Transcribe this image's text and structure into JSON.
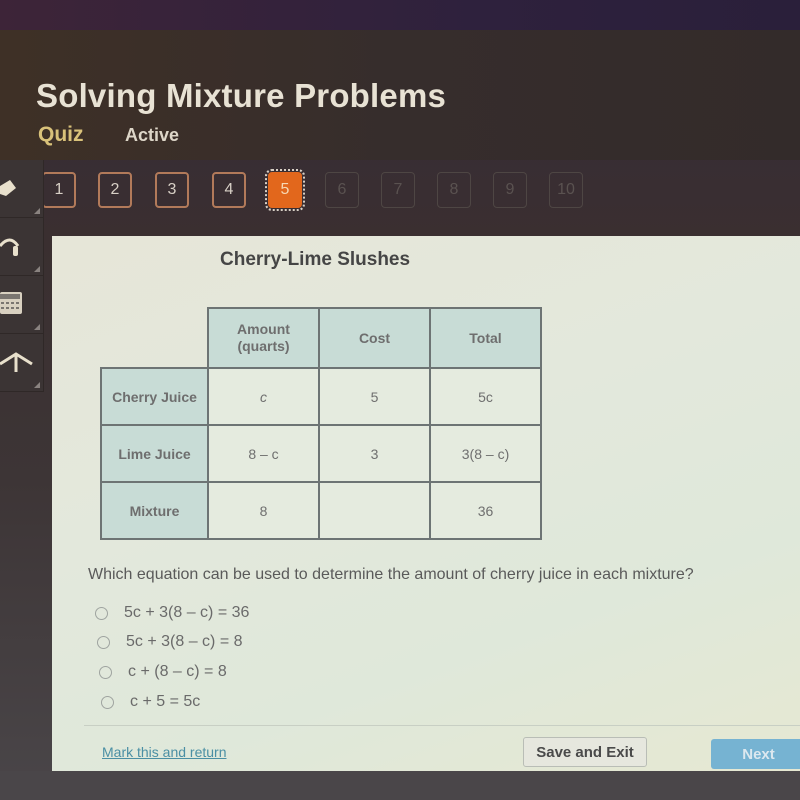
{
  "header": {
    "title": "Solving Mixture Problems",
    "type_label": "Quiz",
    "status_label": "Active"
  },
  "question_nav": {
    "current": 5,
    "items": [
      {
        "label": "1",
        "state": "answered"
      },
      {
        "label": "2",
        "state": "answered"
      },
      {
        "label": "3",
        "state": "answered"
      },
      {
        "label": "4",
        "state": "answered"
      },
      {
        "label": "5",
        "state": "current"
      },
      {
        "label": "6",
        "state": "disabled"
      },
      {
        "label": "7",
        "state": "disabled"
      },
      {
        "label": "8",
        "state": "disabled"
      },
      {
        "label": "9",
        "state": "disabled"
      },
      {
        "label": "10",
        "state": "disabled"
      }
    ]
  },
  "toolbar": {
    "items": [
      {
        "icon": "pencil-icon"
      },
      {
        "icon": "headphones-icon"
      },
      {
        "icon": "calculator-icon"
      },
      {
        "icon": "arrow-up-icon"
      }
    ]
  },
  "table": {
    "title": "Cherry-Lime Slushes",
    "columns": [
      "Amount (quarts)",
      "Cost",
      "Total"
    ],
    "column_lines": [
      [
        "Amount",
        "(quarts)"
      ],
      [
        "Cost"
      ],
      [
        "Total"
      ]
    ],
    "rows": [
      {
        "label": "Cherry Juice",
        "cells": [
          "c",
          "5",
          "5c"
        ]
      },
      {
        "label": "Lime Juice",
        "cells": [
          "8 – c",
          "3",
          "3(8 – c)"
        ]
      },
      {
        "label": "Mixture",
        "cells": [
          "8",
          "",
          "36"
        ]
      }
    ]
  },
  "question": {
    "text": "Which equation can be used to determine the amount of cherry juice in each mixture?",
    "options": [
      {
        "label": "5c + 3(8 – c) = 36",
        "selected": false
      },
      {
        "label": "5c + 3(8 – c) = 8",
        "selected": false
      },
      {
        "label": "c + (8 – c) = 8",
        "selected": false
      },
      {
        "label": "c + 5 = 5c",
        "selected": false
      }
    ]
  },
  "footer": {
    "mark_link": "Mark this and return",
    "save_button": "Save and Exit",
    "next_button": "Next"
  },
  "colors": {
    "accent_current": "#e2671c",
    "quiz_label": "#d9c27a",
    "next_button": "#76b3d2",
    "link": "#4b8fa4",
    "table_header_bg": "#c8dcd6"
  }
}
